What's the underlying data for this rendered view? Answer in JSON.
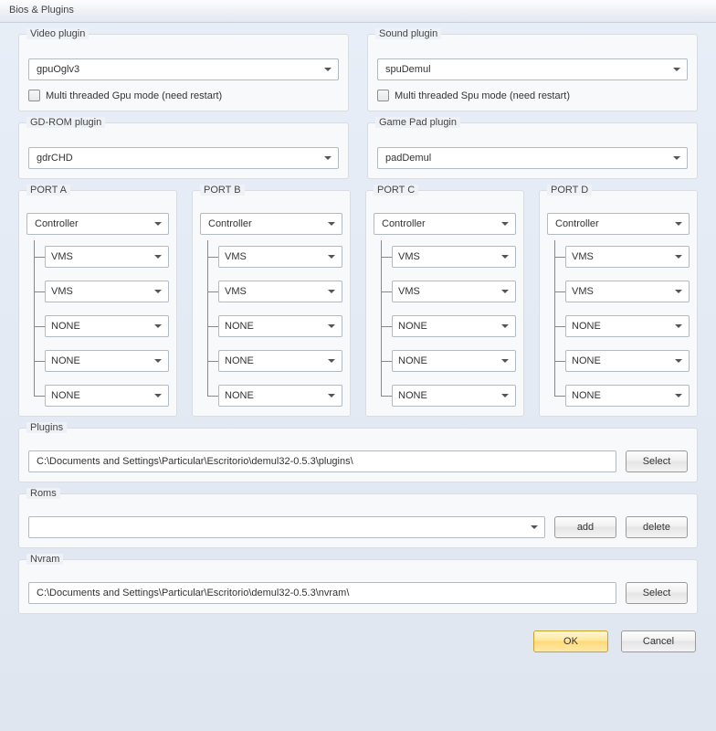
{
  "window_title": "Bios & Plugins",
  "video": {
    "label": "Video plugin",
    "value": "gpuOglv3",
    "checkbox_label": "Multi threaded Gpu mode (need restart)",
    "checked": false
  },
  "sound": {
    "label": "Sound plugin",
    "value": "spuDemul",
    "checkbox_label": "Multi threaded Spu mode (need restart)",
    "checked": false
  },
  "gdrom": {
    "label": "GD-ROM plugin",
    "value": "gdrCHD"
  },
  "gamepad": {
    "label": "Game Pad plugin",
    "value": "padDemul"
  },
  "ports": [
    {
      "label": "PORT A",
      "controller": "Controller",
      "slots": [
        "VMS",
        "VMS",
        "NONE",
        "NONE",
        "NONE"
      ]
    },
    {
      "label": "PORT B",
      "controller": "Controller",
      "slots": [
        "VMS",
        "VMS",
        "NONE",
        "NONE",
        "NONE"
      ]
    },
    {
      "label": "PORT C",
      "controller": "Controller",
      "slots": [
        "VMS",
        "VMS",
        "NONE",
        "NONE",
        "NONE"
      ]
    },
    {
      "label": "PORT D",
      "controller": "Controller",
      "slots": [
        "VMS",
        "VMS",
        "NONE",
        "NONE",
        "NONE"
      ]
    }
  ],
  "plugins_path": {
    "label": "Plugins",
    "value": "C:\\Documents and Settings\\Particular\\Escritorio\\demul32-0.5.3\\plugins\\",
    "select_label": "Select"
  },
  "roms": {
    "label": "Roms",
    "value": "",
    "add_label": "add",
    "delete_label": "delete"
  },
  "nvram": {
    "label": "Nvram",
    "value": "C:\\Documents and Settings\\Particular\\Escritorio\\demul32-0.5.3\\nvram\\",
    "select_label": "Select"
  },
  "buttons": {
    "ok": "OK",
    "cancel": "Cancel"
  }
}
